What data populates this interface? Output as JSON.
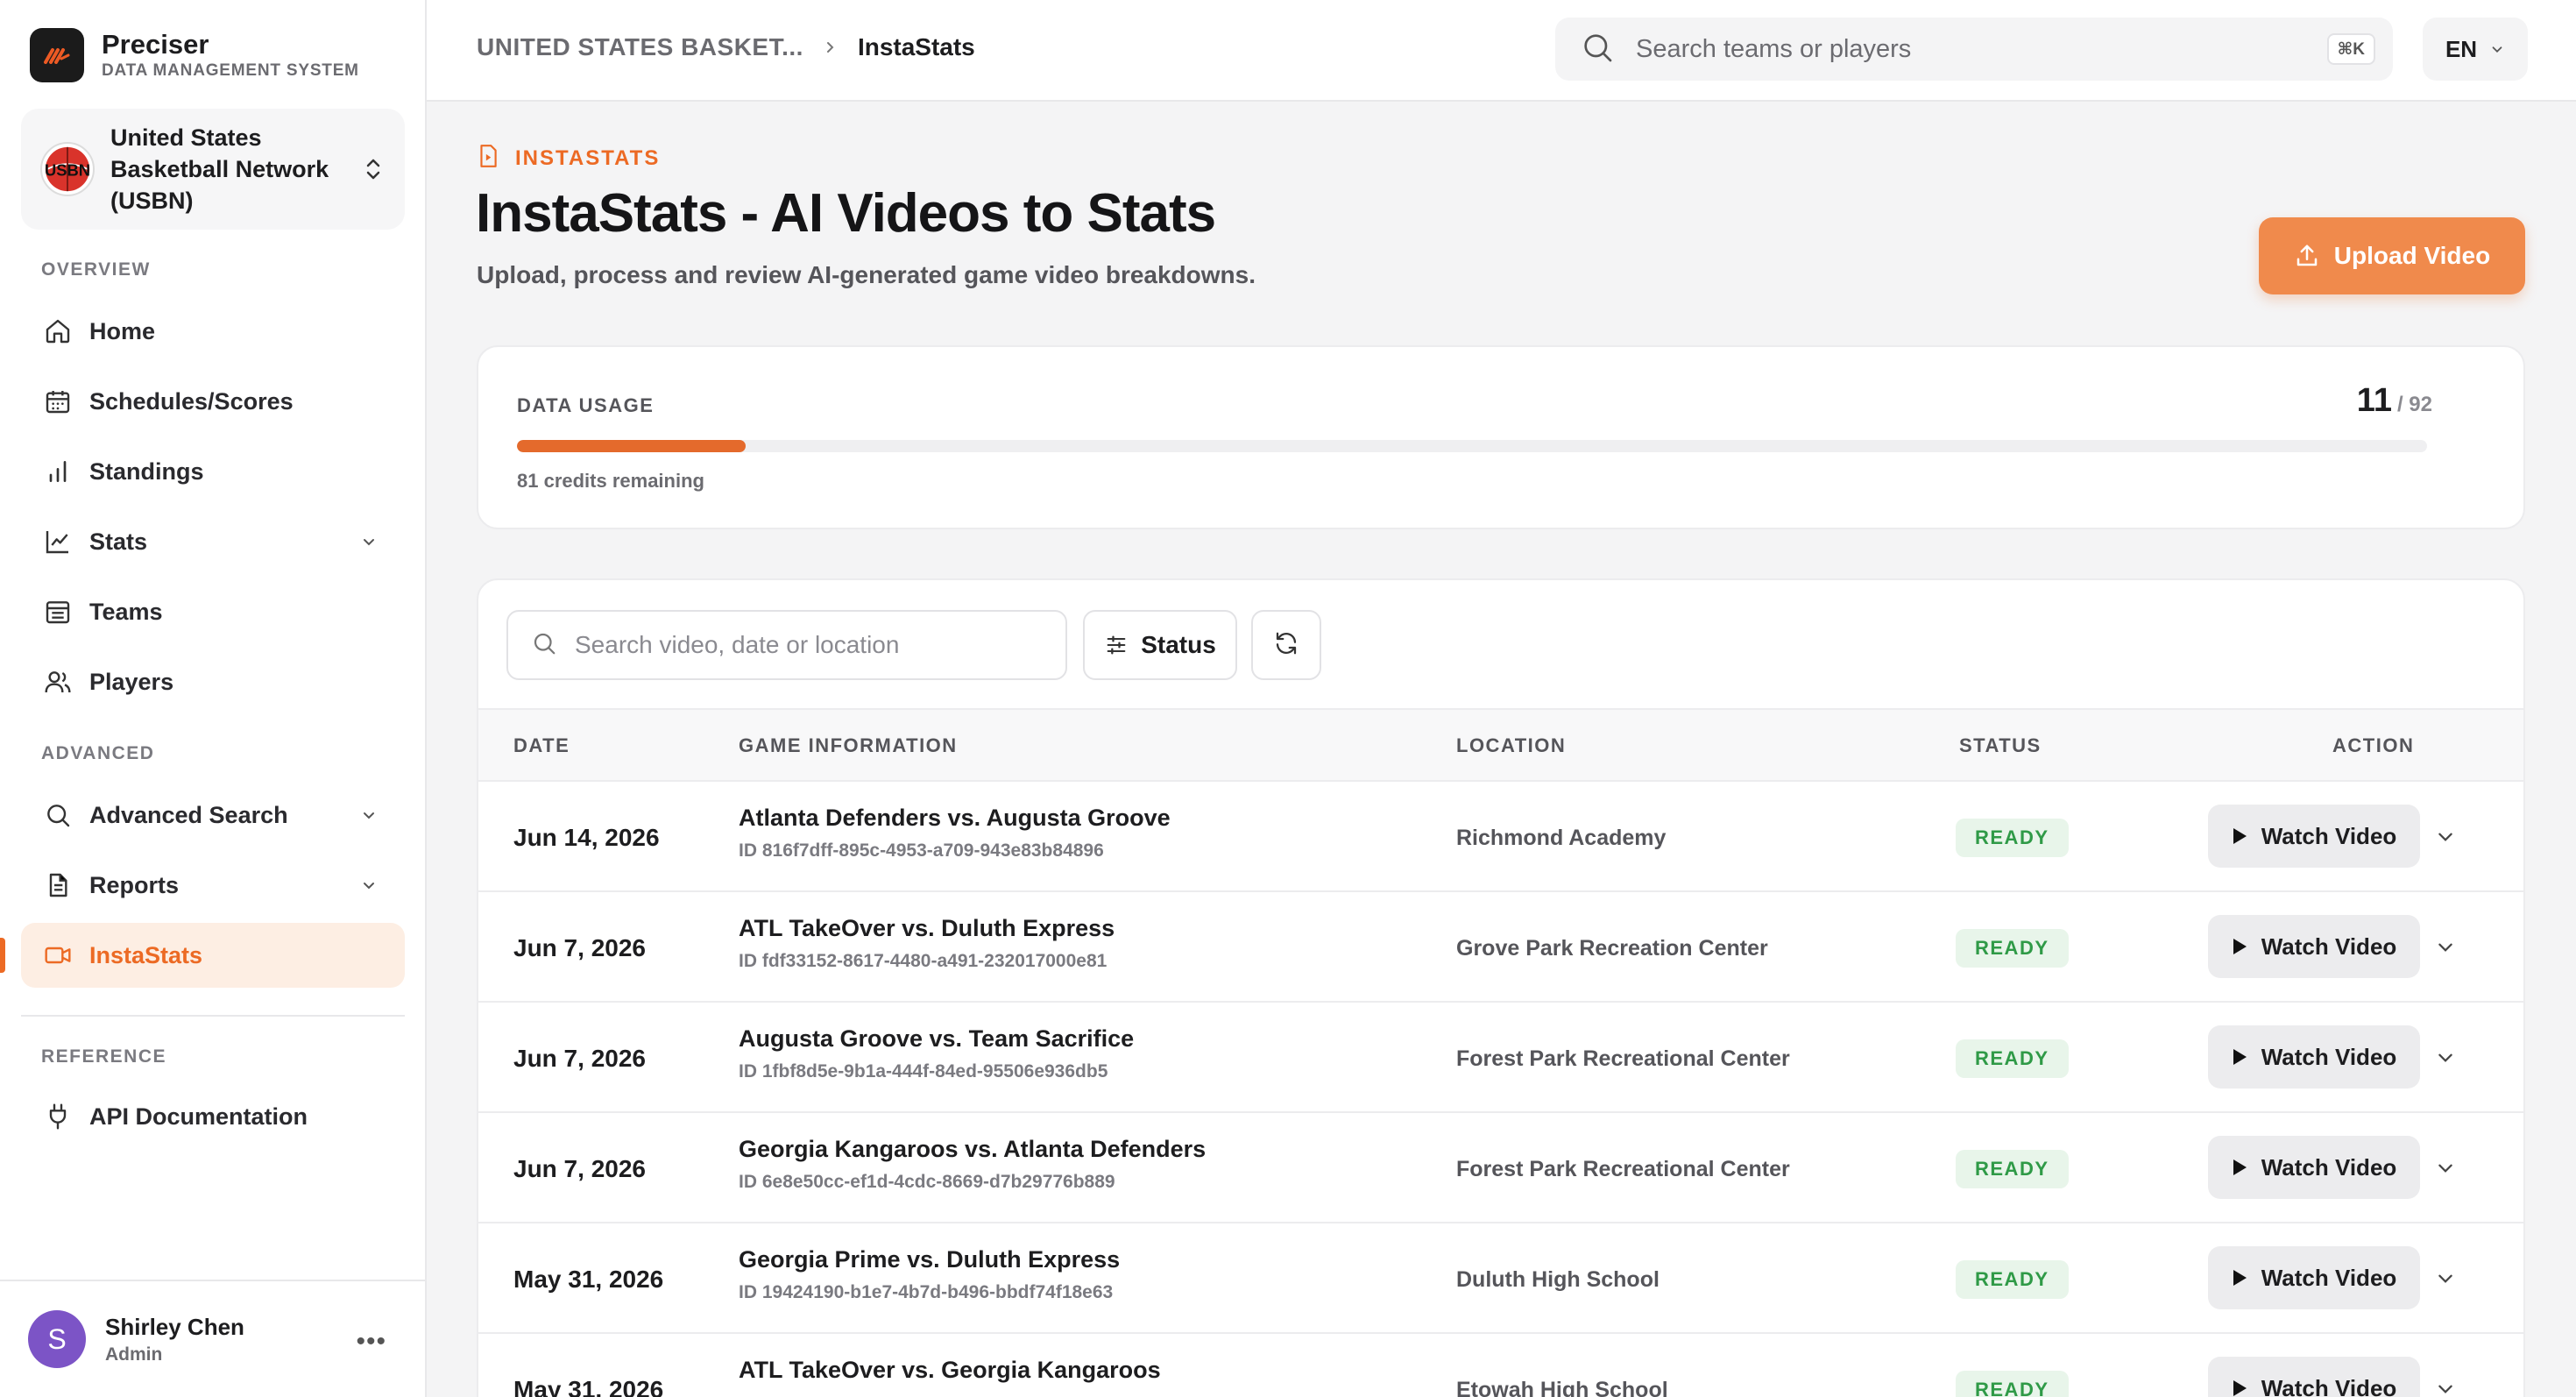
{
  "brand": {
    "name": "Preciser",
    "subtitle": "DATA MANAGEMENT SYSTEM"
  },
  "org": {
    "name": "United States Basketball Network (USBN)",
    "avatar_text": "USBN"
  },
  "sidebar": {
    "overview_label": "OVERVIEW",
    "advanced_label": "ADVANCED",
    "reference_label": "REFERENCE",
    "items": [
      {
        "label": "Home",
        "icon": "home-icon"
      },
      {
        "label": "Schedules/Scores",
        "icon": "calendar-icon"
      },
      {
        "label": "Standings",
        "icon": "bar-chart-icon"
      },
      {
        "label": "Stats",
        "icon": "line-chart-icon"
      },
      {
        "label": "Teams",
        "icon": "teams-icon"
      },
      {
        "label": "Players",
        "icon": "users-icon"
      },
      {
        "label": "Advanced Search",
        "icon": "search-icon"
      },
      {
        "label": "Reports",
        "icon": "document-icon"
      },
      {
        "label": "InstaStats",
        "icon": "video-icon"
      },
      {
        "label": "API Documentation",
        "icon": "plug-icon"
      }
    ]
  },
  "user": {
    "initial": "S",
    "name": "Shirley Chen",
    "role": "Admin"
  },
  "topbar": {
    "breadcrumb_parent": "UNITED STATES BASKET...",
    "breadcrumb_current": "InstaStats",
    "search_placeholder": "Search teams or players",
    "search_shortcut": "⌘K",
    "language": "EN"
  },
  "page": {
    "eyebrow": "INSTASTATS",
    "title": "InstaStats - AI Videos to Stats",
    "subtitle": "Upload, process and review AI-generated game video breakdowns.",
    "upload_label": "Upload Video"
  },
  "usage": {
    "label": "DATA USAGE",
    "used": "11",
    "total": "/ 92",
    "fraction": 0.1196,
    "remaining": "81 credits remaining"
  },
  "table": {
    "search_placeholder": "Search video, date or location",
    "filter_label": "Status",
    "columns": {
      "date": "DATE",
      "game": "GAME INFORMATION",
      "location": "LOCATION",
      "status": "STATUS",
      "action": "ACTION"
    },
    "watch_label": "Watch Video",
    "rows": [
      {
        "date": "Jun 14, 2026",
        "title": "Atlanta Defenders vs. Augusta Groove",
        "id": "ID 816f7dff-895c-4953-a709-943e83b84896",
        "location": "Richmond Academy",
        "status": "READY"
      },
      {
        "date": "Jun 7, 2026",
        "title": "ATL TakeOver vs. Duluth Express",
        "id": "ID fdf33152-8617-4480-a491-232017000e81",
        "location": "Grove Park Recreation Center",
        "status": "READY"
      },
      {
        "date": "Jun 7, 2026",
        "title": "Augusta Groove vs. Team Sacrifice",
        "id": "ID 1fbf8d5e-9b1a-444f-84ed-95506e936db5",
        "location": "Forest Park Recreational Center",
        "status": "READY"
      },
      {
        "date": "Jun 7, 2026",
        "title": "Georgia Kangaroos vs. Atlanta Defenders",
        "id": "ID 6e8e50cc-ef1d-4cdc-8669-d7b29776b889",
        "location": "Forest Park Recreational Center",
        "status": "READY"
      },
      {
        "date": "May 31, 2026",
        "title": "Georgia Prime vs. Duluth Express",
        "id": "ID 19424190-b1e7-4b7d-b496-bbdf74f18e63",
        "location": "Duluth High School",
        "status": "READY"
      },
      {
        "date": "May 31, 2026",
        "title": "ATL TakeOver vs. Georgia Kangaroos",
        "id": "",
        "location": "Etowah High School",
        "status": "READY"
      }
    ]
  },
  "colors": {
    "accent": "#ec6a24",
    "ready": "#2f9a47"
  }
}
